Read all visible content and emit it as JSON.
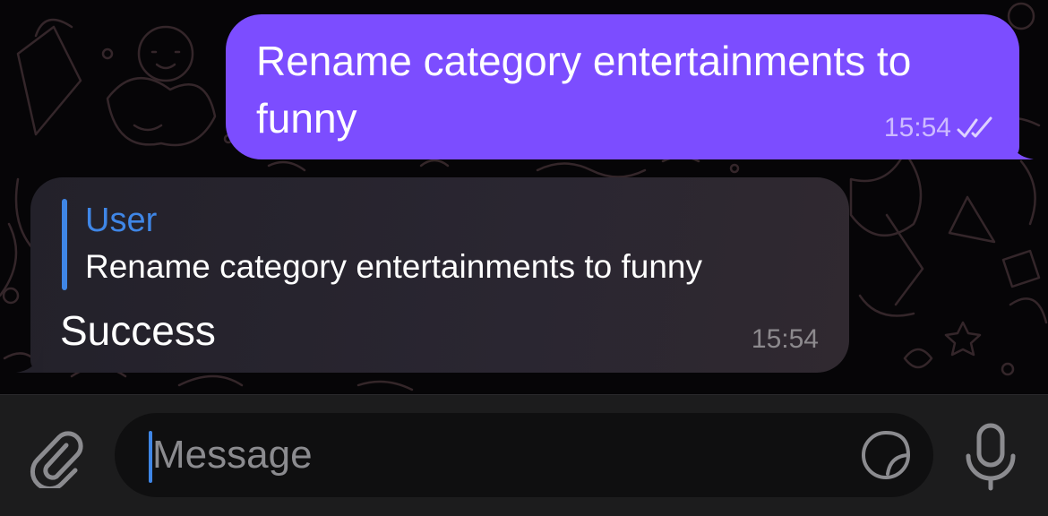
{
  "messages": [
    {
      "direction": "outgoing",
      "text": "Rename category entertainments to funny",
      "time": "15:54",
      "status_icon": "double-check-icon"
    },
    {
      "direction": "incoming",
      "reply_to": {
        "author": "User",
        "text": "Rename category entertainments to funny"
      },
      "text": "Success",
      "time": "15:54"
    }
  ],
  "composer": {
    "placeholder": "Message",
    "attach_icon": "paperclip-icon",
    "sticker_icon": "sticker-icon",
    "mic_icon": "microphone-icon"
  },
  "colors": {
    "outgoing_bubble": "#7c4dff",
    "incoming_bubble": "#2a2631",
    "accent": "#3f86e6",
    "background": "#060507",
    "input_bar": "#1c1c1d"
  }
}
